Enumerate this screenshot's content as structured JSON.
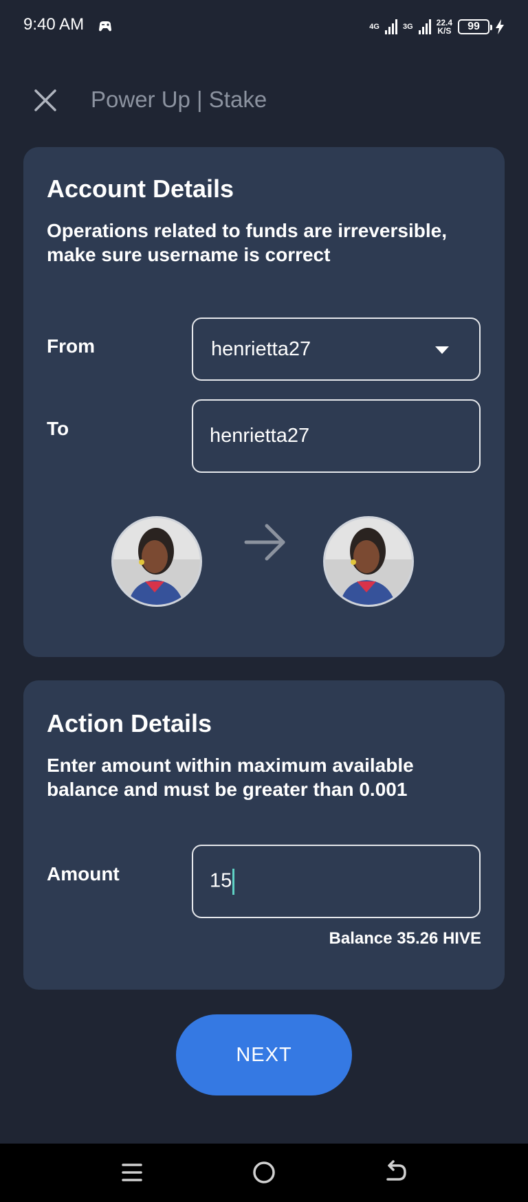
{
  "status_bar": {
    "time": "9:40 AM",
    "app_icon": "gamepad-icon",
    "network_1": "4G",
    "network_2": "3G",
    "speed_value": "22.4",
    "speed_unit": "K/S",
    "battery_level": "99",
    "charging_icon": "lightning-icon"
  },
  "header": {
    "close_icon": "close-icon",
    "title": "Power Up | Stake"
  },
  "account_details": {
    "title": "Account Details",
    "description": "Operations related to funds are irreversible, make sure username is correct",
    "from_label": "From",
    "from_value": "henrietta27",
    "to_label": "To",
    "to_value": "henrietta27",
    "transfer_icon": "arrow-right-icon"
  },
  "action_details": {
    "title": "Action Details",
    "description": "Enter amount within maximum available balance  and must be greater than 0.001",
    "amount_label": "Amount",
    "amount_value": "15",
    "balance_text": "Balance 35.26 HIVE"
  },
  "next_button": {
    "label": "NEXT",
    "color": "#3579e3"
  },
  "nav_bar": {
    "menu_icon": "menu-icon",
    "home_icon": "home-circle-icon",
    "back_icon": "back-icon"
  }
}
